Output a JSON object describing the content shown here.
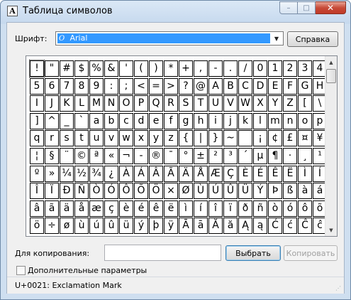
{
  "window": {
    "title": "Таблица символов",
    "controls": {
      "minimize": "–",
      "maximize": "□",
      "close": "✕"
    }
  },
  "font_row": {
    "label": "Шрифт:",
    "selected_font": "Arial",
    "font_icon": "O",
    "help_button": "Справка"
  },
  "characters": [
    [
      "!",
      "\"",
      "#",
      "$",
      "%",
      "&",
      "'",
      "(",
      ")",
      "*",
      "+",
      ",",
      "-",
      ".",
      "/",
      "0",
      "1",
      "2",
      "3",
      "4"
    ],
    [
      "5",
      "6",
      "7",
      "8",
      "9",
      ":",
      ";",
      "<",
      "=",
      ">",
      "?",
      "@",
      "A",
      "B",
      "C",
      "D",
      "E",
      "F",
      "G",
      "H"
    ],
    [
      "I",
      "J",
      "K",
      "L",
      "M",
      "N",
      "O",
      "P",
      "Q",
      "R",
      "S",
      "T",
      "U",
      "V",
      "W",
      "X",
      "Y",
      "Z",
      "[",
      "\\"
    ],
    [
      "]",
      "^",
      "_",
      "`",
      "a",
      "b",
      "c",
      "d",
      "e",
      "f",
      "g",
      "h",
      "i",
      "j",
      "k",
      "l",
      "m",
      "n",
      "o",
      "p"
    ],
    [
      "q",
      "r",
      "s",
      "t",
      "u",
      "v",
      "w",
      "x",
      "y",
      "z",
      "{",
      "|",
      "}",
      "~",
      " ",
      "¡",
      "¢",
      "£",
      "¤",
      "¥"
    ],
    [
      "¦",
      "§",
      "¨",
      "©",
      "ª",
      "«",
      "¬",
      "-",
      "®",
      "¯",
      "°",
      "±",
      "²",
      "³",
      "´",
      "µ",
      "¶",
      "·",
      "¸",
      "¹"
    ],
    [
      "º",
      "»",
      "¼",
      "½",
      "¾",
      "¿",
      "À",
      "Á",
      "Â",
      "Ã",
      "Ä",
      "Å",
      "Æ",
      "Ç",
      "È",
      "É",
      "Ê",
      "Ë",
      "Ì",
      "Í"
    ],
    [
      "Î",
      "Ï",
      "Ð",
      "Ñ",
      "Ò",
      "Ó",
      "Ô",
      "Õ",
      "Ö",
      "×",
      "Ø",
      "Ù",
      "Ú",
      "Û",
      "Ü",
      "Ý",
      "Þ",
      "ß",
      "à",
      "á"
    ],
    [
      "â",
      "ã",
      "ä",
      "å",
      "æ",
      "ç",
      "è",
      "é",
      "ê",
      "ë",
      "ì",
      "í",
      "î",
      "ï",
      "ð",
      "ñ",
      "ò",
      "ó",
      "ô",
      "õ"
    ],
    [
      "ö",
      "÷",
      "ø",
      "ù",
      "ú",
      "û",
      "ü",
      "ý",
      "þ",
      "ÿ",
      "Ā",
      "ā",
      "Ă",
      "ă",
      "Ą",
      "ą",
      "Ć",
      "ć",
      "Ĉ",
      "ĉ"
    ]
  ],
  "copy_row": {
    "label": "Для копирования:",
    "value": "",
    "select_button": "Выбрать",
    "copy_button": "Копировать"
  },
  "advanced": {
    "label": "Дополнительные параметры",
    "checked": false
  },
  "status": {
    "text": "U+0021: Exclamation Mark"
  },
  "colors": {
    "selection": "#3399ff",
    "close_button": "#c74a38"
  }
}
